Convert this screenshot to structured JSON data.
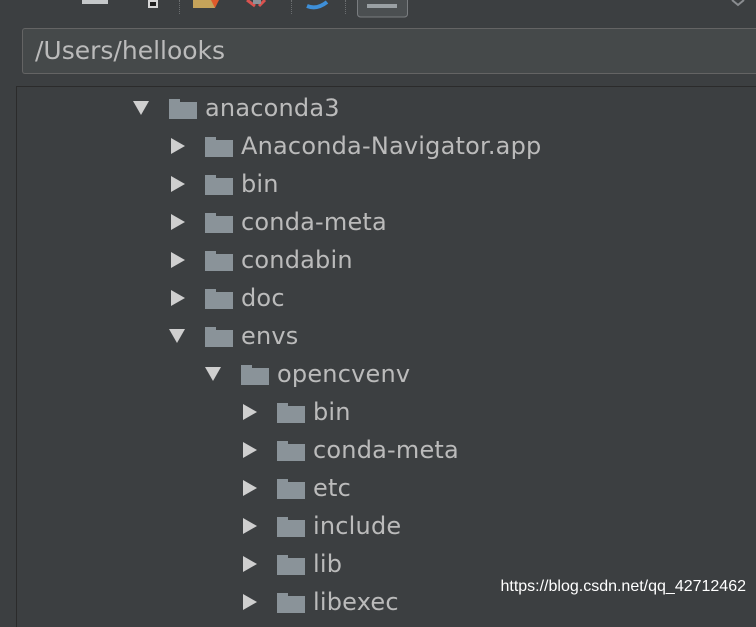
{
  "toolbar": {
    "icons": [
      "home-icon",
      "desktop-icon",
      "new-folder-icon",
      "delete-icon",
      "refresh-icon",
      "show-hidden-icon"
    ]
  },
  "path_field": {
    "value": "/Users/hellooks"
  },
  "tree": {
    "nodes": [
      {
        "label": "anaconda3",
        "expanded": true,
        "depth": 0
      },
      {
        "label": "Anaconda-Navigator.app",
        "expanded": false,
        "depth": 1
      },
      {
        "label": "bin",
        "expanded": false,
        "depth": 1
      },
      {
        "label": "conda-meta",
        "expanded": false,
        "depth": 1
      },
      {
        "label": "condabin",
        "expanded": false,
        "depth": 1
      },
      {
        "label": "doc",
        "expanded": false,
        "depth": 1
      },
      {
        "label": "envs",
        "expanded": true,
        "depth": 1
      },
      {
        "label": "opencvenv",
        "expanded": true,
        "depth": 2
      },
      {
        "label": "bin",
        "expanded": false,
        "depth": 3
      },
      {
        "label": "conda-meta",
        "expanded": false,
        "depth": 3
      },
      {
        "label": "etc",
        "expanded": false,
        "depth": 3
      },
      {
        "label": "include",
        "expanded": false,
        "depth": 3
      },
      {
        "label": "lib",
        "expanded": false,
        "depth": 3
      },
      {
        "label": "libexec",
        "expanded": false,
        "depth": 3
      }
    ]
  },
  "watermark": {
    "text": "https://blog.csdn.net/qq_42712462"
  }
}
